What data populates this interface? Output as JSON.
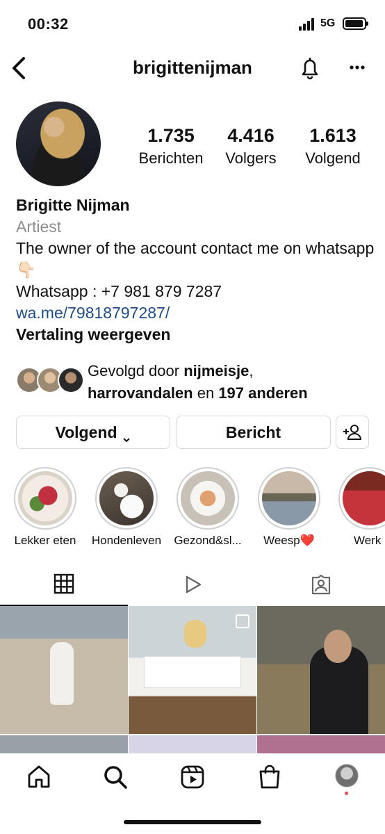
{
  "status_bar": {
    "time": "00:32",
    "network": "5G"
  },
  "header": {
    "username": "brigittenijman"
  },
  "profile": {
    "stats": [
      {
        "value": "1.735",
        "label": "Berichten"
      },
      {
        "value": "4.416",
        "label": "Volgers"
      },
      {
        "value": "1.613",
        "label": "Volgend"
      }
    ],
    "name": "Brigitte Nijman",
    "category": "Artiest",
    "bio_line1": "The owner of the account contact me on whatsapp 👇🏻",
    "bio_line2": "Whatsapp : +7 981 879 7287",
    "link": "wa.me/79818797287/",
    "translate": "Vertaling weergeven"
  },
  "followed_by": {
    "prefix": "Gevolgd door ",
    "user1": "nijmeisje",
    "sep": ", ",
    "user2": "harrovandalen",
    "mid": " en ",
    "others": "197 anderen"
  },
  "actions": {
    "follow": "Volgend",
    "message": "Bericht"
  },
  "highlights": [
    {
      "label": "Lekker eten"
    },
    {
      "label": "Hondenleven"
    },
    {
      "label": "Gezond&sl..."
    },
    {
      "label": "Weesp❤️"
    },
    {
      "label": "Werk"
    }
  ],
  "tabs": [
    {
      "icon": "grid-icon"
    },
    {
      "icon": "reels-play-icon"
    },
    {
      "icon": "tagged-person-icon"
    }
  ],
  "bottom_nav": [
    {
      "icon": "home-icon"
    },
    {
      "icon": "search-icon"
    },
    {
      "icon": "reels-icon"
    },
    {
      "icon": "shop-bag-icon"
    },
    {
      "icon": "profile-avatar-icon"
    }
  ],
  "colors": {
    "link": "#1e4d8a",
    "muted": "#8e8e8e",
    "notification_dot": "#ed4956"
  }
}
